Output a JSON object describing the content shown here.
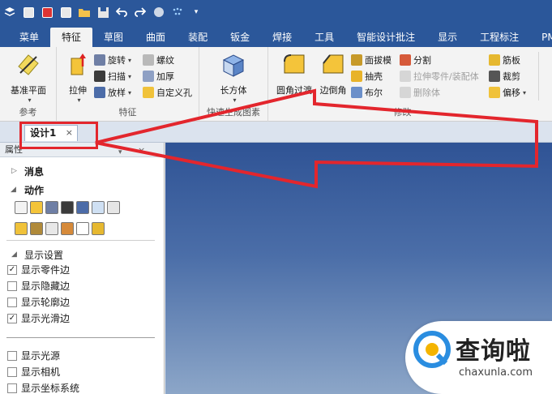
{
  "tabs": [
    "菜单",
    "特征",
    "草图",
    "曲面",
    "装配",
    "钣金",
    "焊接",
    "工具",
    "智能设计批注",
    "显示",
    "工程标注",
    "PMI"
  ],
  "active_tab": "特征",
  "ribbon": {
    "ref_plane": "基准平面",
    "ref_group": "参考",
    "extrude": "拉伸",
    "revolve": "旋转",
    "sweep": "扫描",
    "loft": "放样",
    "thread": "螺纹",
    "thicken": "加厚",
    "custom_hole": "自定义孔",
    "feature_group": "特征",
    "box": "长方体",
    "quick_group": "快速生成图素",
    "fillet": "圆角过渡",
    "chamfer": "边倒角",
    "draft": "面拔模",
    "shell": "抽壳",
    "boolean": "布尔",
    "split": "分割",
    "stretch_part": "拉伸零件/装配体",
    "delete_body": "删除体",
    "rib": "筋板",
    "cut": "裁剪",
    "offset": "偏移",
    "modify_group": "修改"
  },
  "doc_tab": {
    "label": "设计1",
    "close": "×"
  },
  "panel": {
    "header": "属性",
    "messages": "消息",
    "actions": "动作",
    "display_settings": "显示设置",
    "options": [
      {
        "label": "显示零件边",
        "checked": true
      },
      {
        "label": "显示隐藏边",
        "checked": false
      },
      {
        "label": "显示轮廓边",
        "checked": false
      },
      {
        "label": "显示光滑边",
        "checked": true
      }
    ],
    "options2": [
      {
        "label": "显示光源",
        "checked": false
      },
      {
        "label": "显示相机",
        "checked": false
      },
      {
        "label": "显示坐标系统",
        "checked": false
      }
    ]
  },
  "watermark": {
    "title": "查询啦",
    "url": "chaxunla.com"
  },
  "colors": {
    "titlebar": "#2b579a",
    "annotation": "#e3262d",
    "viewport_top": "#2f5395",
    "viewport_bottom": "#8ca6c8"
  }
}
